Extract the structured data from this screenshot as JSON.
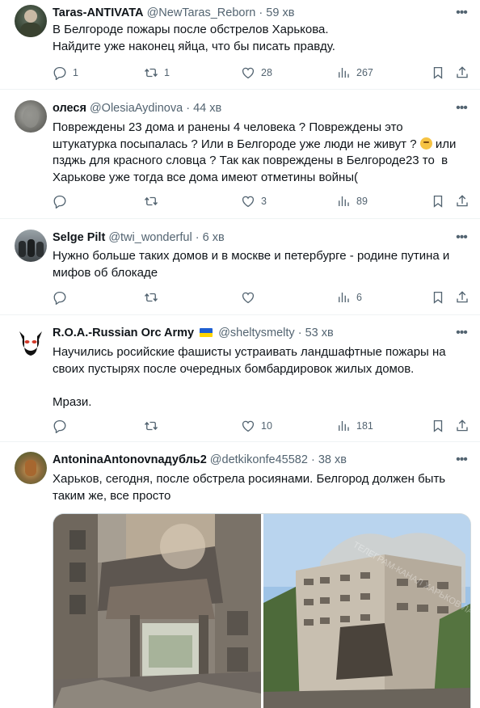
{
  "tweets": [
    {
      "name": "Taras-ANTIVATA",
      "handle": "@NewTaras_Reborn",
      "time": "59 хв",
      "text": "В Белгороде пожары после обстрелов Харькова.\nНайдите уже наконец яйца, что бы писать правду.",
      "replies": "1",
      "retweets": "1",
      "likes": "28",
      "views": "267"
    },
    {
      "name": "олеся",
      "handle": "@OlesiaAydinova",
      "time": "44 хв",
      "text_a": "Повреждены 23 дома и ранены 4 человека ? Повреждены это штукатурка посыпалась ? Или в Белгороде уже люди не живут ? ",
      "text_b": " или пзджь для красного словца ? Так как повреждены в Белгороде23 то  в Харькове уже тогда все дома имеют отметины войны(",
      "replies": "",
      "retweets": "",
      "likes": "3",
      "views": "89"
    },
    {
      "name": "Selge Pilt",
      "handle": "@twi_wonderful",
      "time": "6 хв",
      "text": "Нужно больше таких домов и в москве и петербурге - родине путина и мифов об блокаде",
      "replies": "",
      "retweets": "",
      "likes": "",
      "views": "6"
    },
    {
      "name": "R.O.A.-Russian Orc Army",
      "handle": "@sheltysmelty",
      "time": "53 хв",
      "text": "Научились росийские фашисты устраивать ландшафтные пожары на своих пустырях после очередных бомбардировок жилых домов.\n\nМрази.",
      "replies": "",
      "retweets": "",
      "likes": "10",
      "views": "181"
    },
    {
      "name": "AntoninaAntonovnaдубль2",
      "handle": "@detkikonfe45582",
      "time": "38 хв",
      "text": "Харьков, сегодня, после обстрела росиянами. Белгород должен быть таким же, все просто",
      "watermark": "ТЕЛЕГРАМ-КАНАЛ ХАРЬКОВ ЛАЙФ"
    }
  ],
  "separator": "·",
  "icons": [
    "more-icon",
    "reply-icon",
    "retweet-icon",
    "like-icon",
    "views-icon",
    "bookmark-icon",
    "share-icon"
  ],
  "colors": {
    "text": "#0f1419",
    "muted": "#536471",
    "divider": "#eff3f4",
    "flag_blue": "#1f5fd1",
    "flag_yellow": "#ffd500"
  }
}
